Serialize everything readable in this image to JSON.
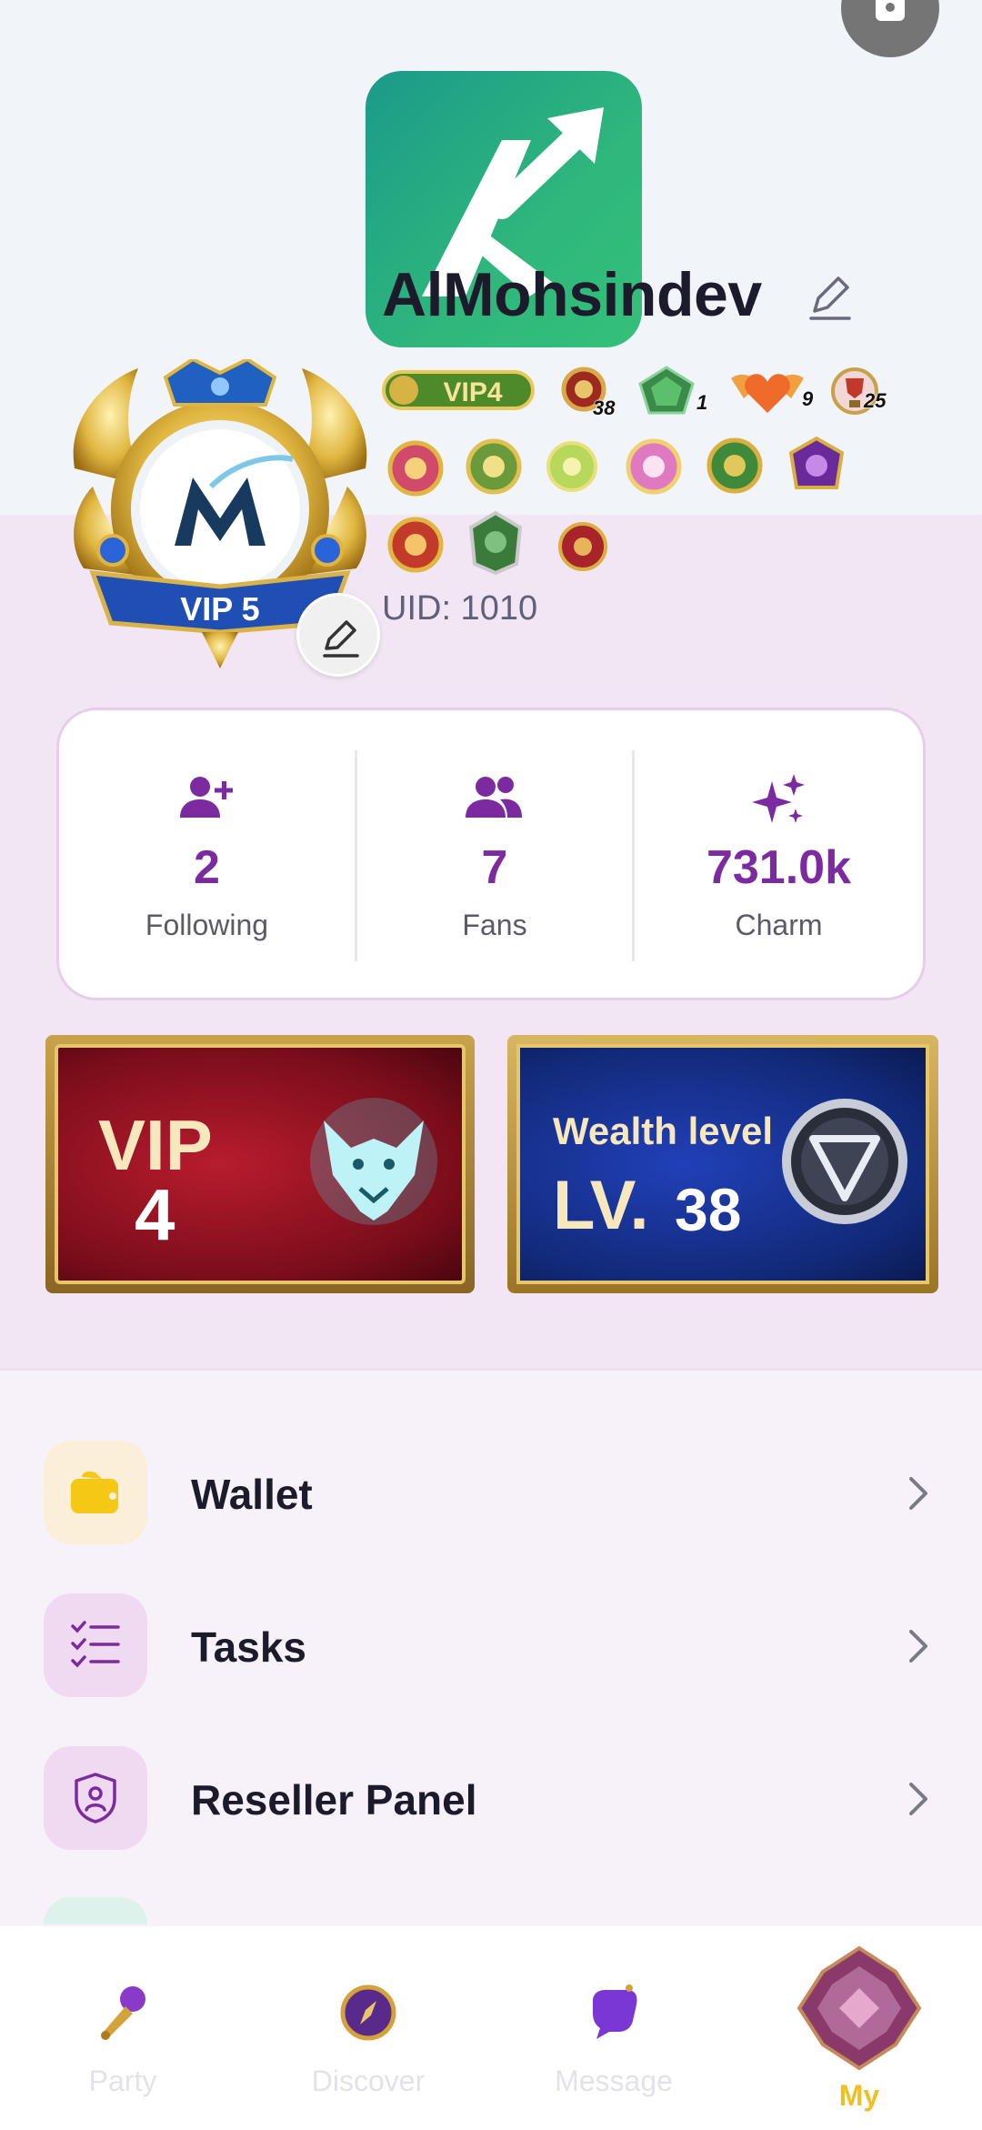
{
  "profile": {
    "username": "AlMohsindev",
    "uid": "UID: 1010",
    "avatar_frame_label": "VIP 5"
  },
  "badges": [
    {
      "name": "vip4-badge",
      "text": "VIP4"
    },
    {
      "name": "wealth-badge",
      "num": "38"
    },
    {
      "name": "green-gem-badge",
      "num": "1"
    },
    {
      "name": "heart-wings-badge",
      "num": "9"
    },
    {
      "name": "trophy-badge",
      "num": "25"
    }
  ],
  "stats": {
    "following": {
      "value": "2",
      "label": "Following"
    },
    "fans": {
      "value": "7",
      "label": "Fans"
    },
    "charm": {
      "value": "731.0k",
      "label": "Charm"
    }
  },
  "banners": {
    "vip": {
      "line1": "VIP",
      "line2": "4"
    },
    "wealth": {
      "line1": "Wealth level",
      "prefix": "LV.",
      "level": "38"
    }
  },
  "menu": [
    {
      "label": "Wallet",
      "icon": "wallet-icon"
    },
    {
      "label": "Tasks",
      "icon": "tasks-icon"
    },
    {
      "label": "Reseller Panel",
      "icon": "shield-user-icon"
    }
  ],
  "nav": {
    "party": "Party",
    "discover": "Discover",
    "message": "Message",
    "my": "My"
  },
  "colors": {
    "accent_purple": "#7c2aa0",
    "nav_active": "#f1be24",
    "wallet_icon": "#f5c816"
  }
}
